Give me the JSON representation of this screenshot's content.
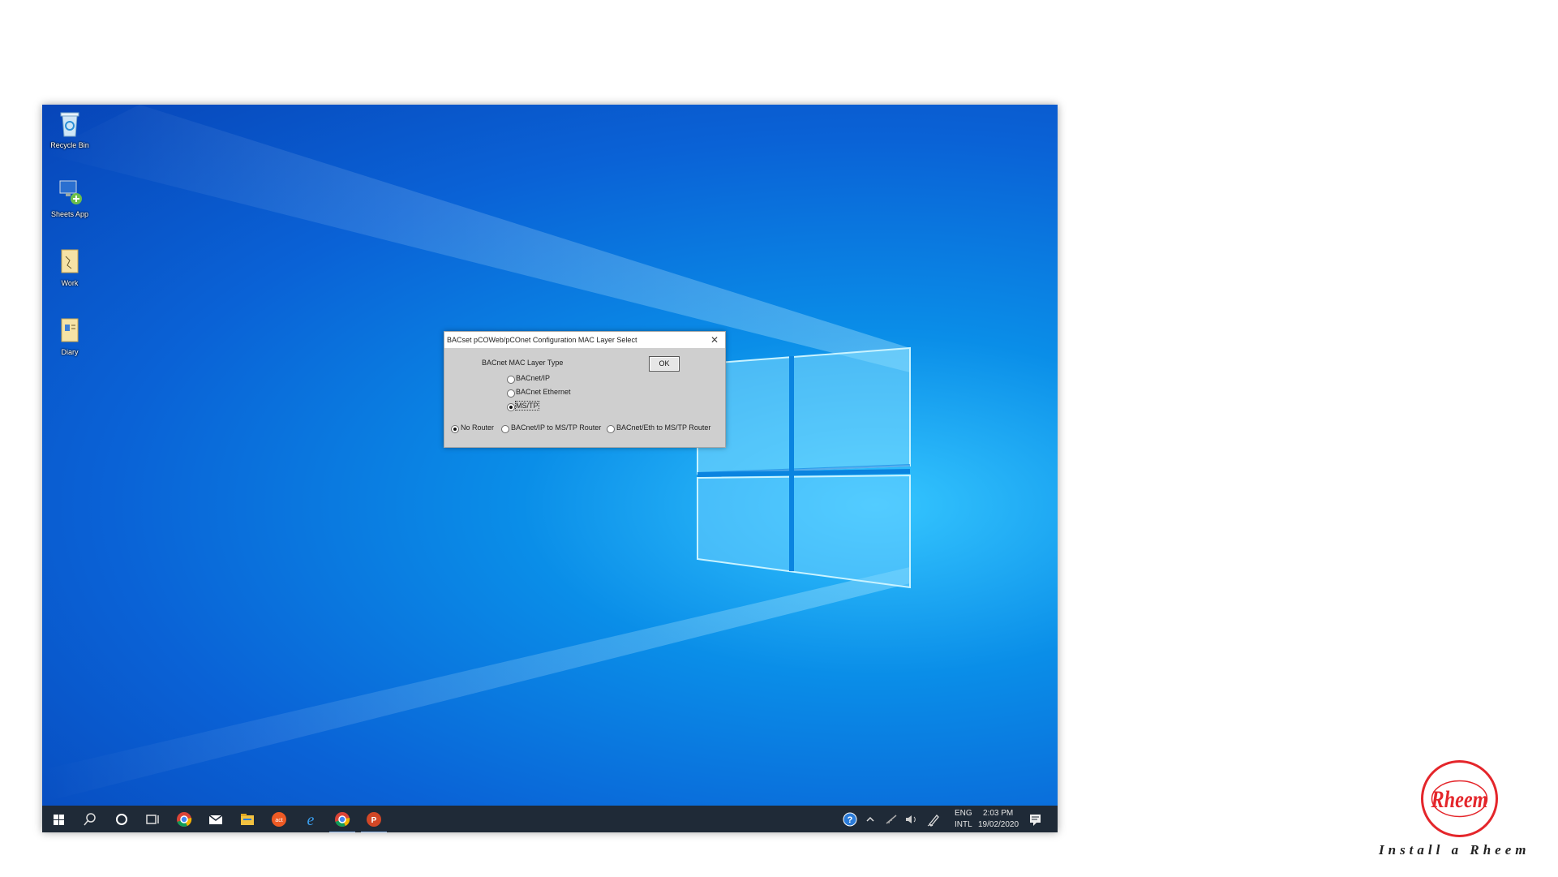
{
  "desktop": {
    "icons": [
      {
        "label": "Recycle Bin",
        "icon": "recycle-bin-icon"
      },
      {
        "label": "Sheets App",
        "icon": "remote-computer-icon"
      },
      {
        "label": "Work",
        "icon": "folder-icon"
      },
      {
        "label": "Diary",
        "icon": "folder-icon"
      }
    ]
  },
  "dialog": {
    "title": "BACset pCOWeb/pCOnet Configuration MAC Layer Select",
    "close_glyph": "✕",
    "section_label": "BACnet MAC Layer Type",
    "ok_label": "OK",
    "mac_options": [
      {
        "label": "BACnet/IP",
        "selected": false
      },
      {
        "label": "BACnet Ethernet",
        "selected": false
      },
      {
        "label": "MS/TP",
        "selected": true
      }
    ],
    "router_options": [
      {
        "label": "No Router",
        "selected": true
      },
      {
        "label": "BACnet/IP to MS/TP Router",
        "selected": false
      },
      {
        "label": "BACnet/Eth to MS/TP Router",
        "selected": false
      }
    ]
  },
  "taskbar": {
    "apps": [
      "start-icon",
      "search-icon",
      "cortana-icon",
      "task-view-icon",
      "chrome-icon",
      "mail-icon",
      "file-explorer-icon",
      "app-icon",
      "edge-icon",
      "chrome-icon",
      "powerpoint-icon"
    ],
    "tray": {
      "language_top": "ENG",
      "language_bottom": "INTL",
      "time": "2:03 PM",
      "date": "19/02/2020"
    }
  },
  "branding": {
    "logo_text": "Rheem",
    "tagline": "Install a Rheem",
    "brand_color": "#e4262b"
  }
}
